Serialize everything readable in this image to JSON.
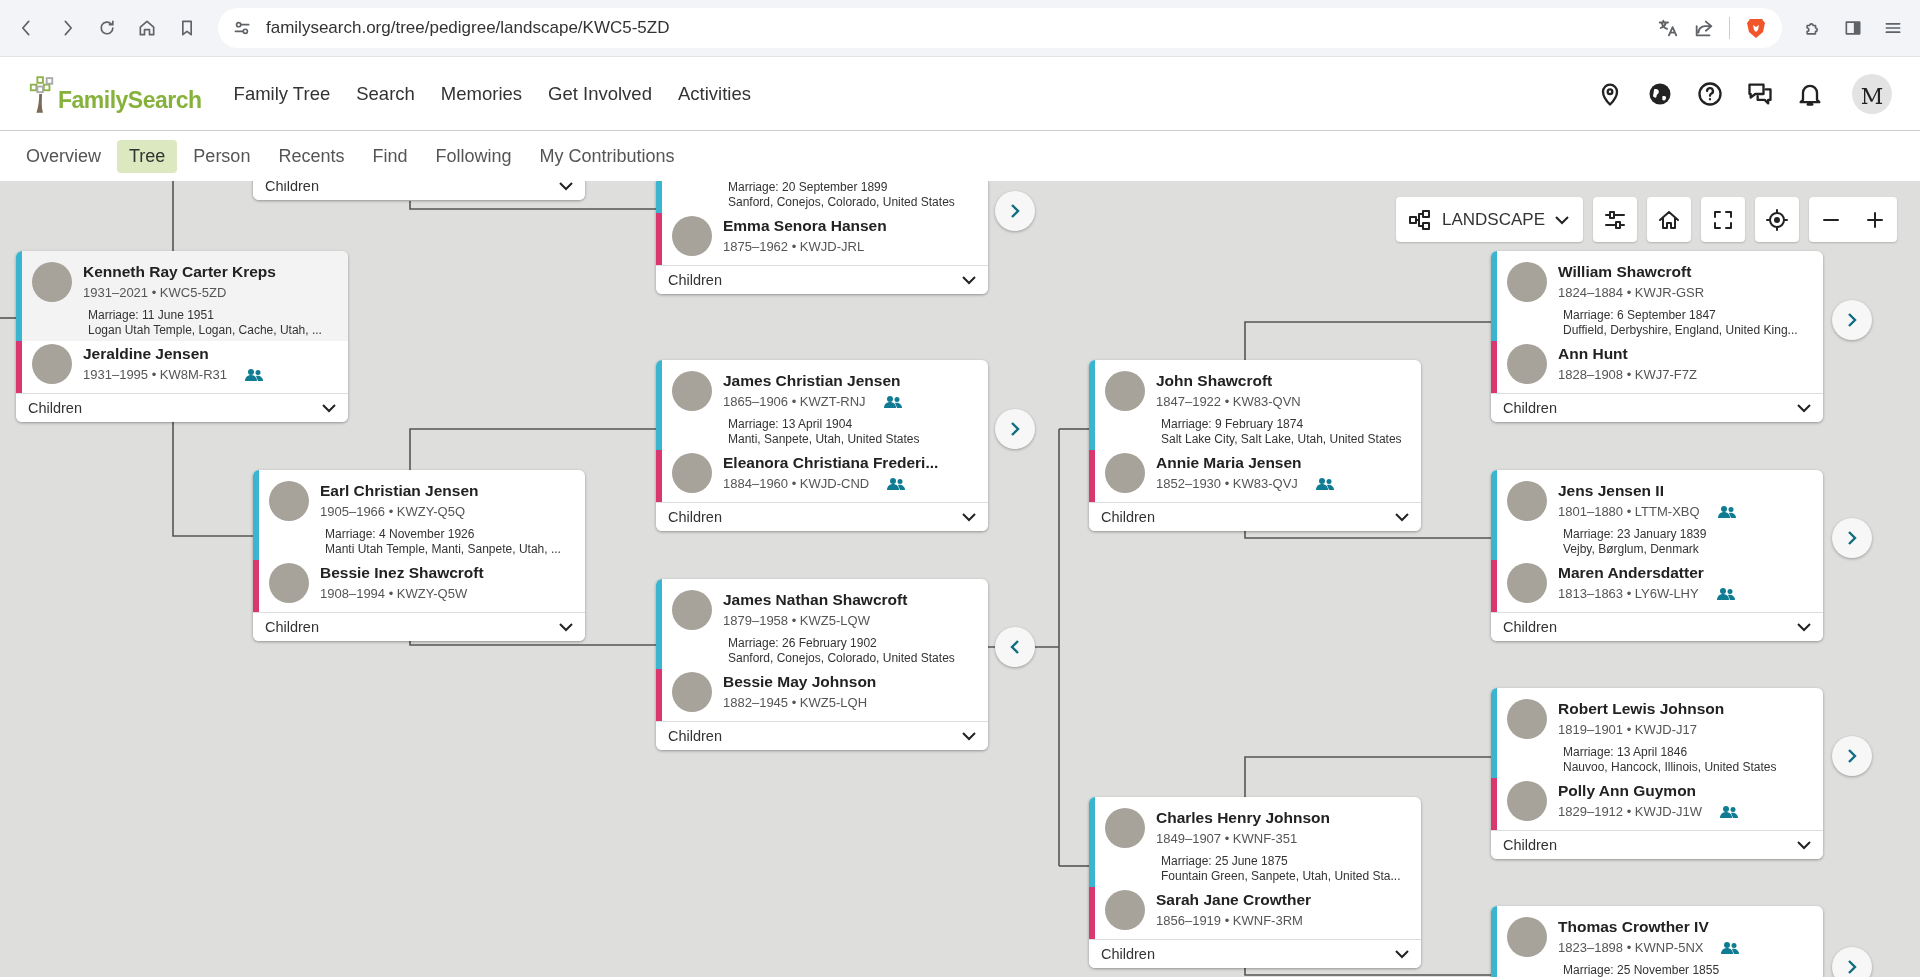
{
  "browser": {
    "url": "familysearch.org/tree/pedigree/landscape/KWC5-5ZD"
  },
  "header": {
    "logo": "FamilySearch",
    "nav": [
      "Family Tree",
      "Search",
      "Memories",
      "Get Involved",
      "Activities"
    ],
    "avatar": "M"
  },
  "subnav": [
    {
      "label": "Overview",
      "selected": false
    },
    {
      "label": "Tree",
      "selected": true
    },
    {
      "label": "Person",
      "selected": false
    },
    {
      "label": "Recents",
      "selected": false
    },
    {
      "label": "Find",
      "selected": false
    },
    {
      "label": "Following",
      "selected": false
    },
    {
      "label": "My Contributions",
      "selected": false
    }
  ],
  "toolbar": {
    "view": "LANDSCAPE"
  },
  "couples": [
    {
      "selected": false,
      "children_label": "Children"
    },
    {
      "selected": false,
      "marriage": {
        "date": "Marriage: 20 September 1899",
        "place": "Sanford, Conejos, Colorado, United States"
      },
      "wife": {
        "name": "Emma Senora Hansen",
        "dates": "1875–1962 • KWJD-JRL",
        "relatives_icon": false
      },
      "children_label": "Children"
    },
    {
      "selected": true,
      "husband": {
        "name": "Kenneth Ray Carter Kreps",
        "dates": "1931–2021 • KWC5-5ZD",
        "relatives_icon": false
      },
      "marriage": {
        "date": "Marriage: 11 June 1951",
        "place": "Logan Utah Temple, Logan, Cache, Utah, ..."
      },
      "wife": {
        "name": "Jeraldine Jensen",
        "dates": "1931–1995 • KW8M-R31",
        "relatives_icon": true
      },
      "children_label": "Children"
    },
    {
      "selected": false,
      "husband": {
        "name": "Earl Christian Jensen",
        "dates": "1905–1966 • KWZY-Q5Q",
        "relatives_icon": false
      },
      "marriage": {
        "date": "Marriage: 4 November 1926",
        "place": "Manti Utah Temple, Manti, Sanpete, Utah, ..."
      },
      "wife": {
        "name": "Bessie Inez Shawcroft",
        "dates": "1908–1994 • KWZY-Q5W",
        "relatives_icon": false
      },
      "children_label": "Children"
    },
    {
      "selected": false,
      "husband": {
        "name": "James Christian Jensen",
        "dates": "1865–1906 • KWZT-RNJ",
        "relatives_icon": true
      },
      "marriage": {
        "date": "Marriage: 13 April 1904",
        "place": "Manti, Sanpete, Utah, United States"
      },
      "wife": {
        "name": "Eleanora Christiana Frederi...",
        "dates": "1884–1960 • KWJD-CND",
        "relatives_icon": true
      },
      "children_label": "Children"
    },
    {
      "selected": false,
      "husband": {
        "name": "James Nathan Shawcroft",
        "dates": "1879–1958 • KWZ5-LQW",
        "relatives_icon": false
      },
      "marriage": {
        "date": "Marriage: 26 February 1902",
        "place": "Sanford, Conejos, Colorado, United States"
      },
      "wife": {
        "name": "Bessie May Johnson",
        "dates": "1882–1945 • KWZ5-LQH",
        "relatives_icon": false
      },
      "children_label": "Children"
    },
    {
      "selected": false,
      "husband": {
        "name": "John Shawcroft",
        "dates": "1847–1922 • KW83-QVN",
        "relatives_icon": false
      },
      "marriage": {
        "date": "Marriage: 9 February 1874",
        "place": "Salt Lake City, Salt Lake, Utah, United States"
      },
      "wife": {
        "name": "Annie Maria Jensen",
        "dates": "1852–1930 • KW83-QVJ",
        "relatives_icon": true
      },
      "children_label": "Children"
    },
    {
      "selected": false,
      "husband": {
        "name": "Charles Henry Johnson",
        "dates": "1849–1907 • KWNF-351",
        "relatives_icon": false
      },
      "marriage": {
        "date": "Marriage: 25 June 1875",
        "place": "Fountain Green, Sanpete, Utah, United Sta..."
      },
      "wife": {
        "name": "Sarah Jane Crowther",
        "dates": "1856–1919 • KWNF-3RM",
        "relatives_icon": false
      },
      "children_label": "Children"
    },
    {
      "selected": false,
      "husband": {
        "name": "William Shawcroft",
        "dates": "1824–1884 • KWJR-GSR",
        "relatives_icon": false
      },
      "marriage": {
        "date": "Marriage: 6 September 1847",
        "place": "Duffield, Derbyshire, England, United King..."
      },
      "wife": {
        "name": "Ann Hunt",
        "dates": "1828–1908 • KWJ7-F7Z",
        "relatives_icon": false
      },
      "children_label": "Children"
    },
    {
      "selected": false,
      "husband": {
        "name": "Jens Jensen II",
        "dates": "1801–1880 • LTTM-XBQ",
        "relatives_icon": true
      },
      "marriage": {
        "date": "Marriage: 23 January 1839",
        "place": "Vejby, Børglum, Denmark"
      },
      "wife": {
        "name": "Maren Andersdatter",
        "dates": "1813–1863 • LY6W-LHY",
        "relatives_icon": true
      },
      "children_label": "Children"
    },
    {
      "selected": false,
      "husband": {
        "name": "Robert Lewis Johnson",
        "dates": "1819–1901 • KWJD-J17",
        "relatives_icon": false
      },
      "marriage": {
        "date": "Marriage: 13 April 1846",
        "place": "Nauvoo, Hancock, Illinois, United States"
      },
      "wife": {
        "name": "Polly Ann Guymon",
        "dates": "1829–1912 • KWJD-J1W",
        "relatives_icon": true
      },
      "children_label": "Children"
    },
    {
      "selected": false,
      "husband": {
        "name": "Thomas Crowther IV",
        "dates": "1823–1898 • KWNP-5NX",
        "relatives_icon": true
      },
      "marriage": {
        "date": "Marriage: 25 November 1855"
      }
    }
  ],
  "nav_buttons": [
    {
      "kind": "right"
    },
    {
      "kind": "right"
    },
    {
      "kind": "left"
    },
    {
      "kind": "right"
    },
    {
      "kind": "right"
    },
    {
      "kind": "right"
    },
    {
      "kind": "right"
    }
  ]
}
